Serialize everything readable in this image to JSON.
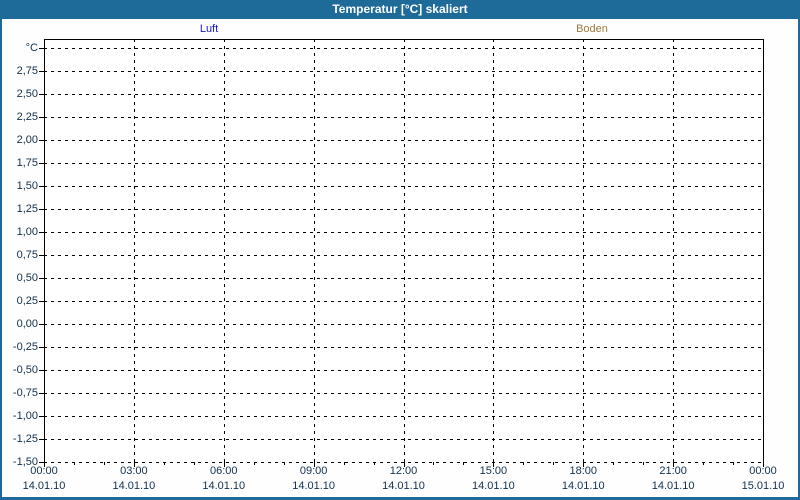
{
  "window": {
    "title": "Temperatur [°C] skaliert",
    "titlebar_color": "#1e6b9a",
    "border_color": "#1e6b9a",
    "background_color": "#fdfefd"
  },
  "chart_data": {
    "type": "line",
    "title": "Temperatur [°C] skaliert",
    "grid": "dashed",
    "grid_color": "#000000",
    "plot_background": "#ffffff",
    "axis_label_color": "#13304c",
    "y_axis": {
      "unit": "°C",
      "min": -1.5,
      "max": 3.0,
      "tick_step": 0.25,
      "tick_labels": [
        "°C",
        "2,75",
        "2,50",
        "2,25",
        "2,00",
        "1,75",
        "1,50",
        "1,25",
        "1,00",
        "0,75",
        "0,50",
        "0,25",
        "0,00",
        "-0,25",
        "-0,50",
        "-0,75",
        "-1,00",
        "-1,25",
        "-1,50"
      ]
    },
    "x_axis": {
      "major_tick_interval_hours": 3,
      "minor_tick_interval_hours": 1,
      "major_ticks": [
        {
          "time": "00:00",
          "date": "14.01.10"
        },
        {
          "time": "03:00",
          "date": "14.01.10"
        },
        {
          "time": "06:00",
          "date": "14.01.10"
        },
        {
          "time": "09:00",
          "date": "14.01.10"
        },
        {
          "time": "12:00",
          "date": "14.01.10"
        },
        {
          "time": "15:00",
          "date": "14.01.10"
        },
        {
          "time": "18:00",
          "date": "14.01.10"
        },
        {
          "time": "21:00",
          "date": "14.01.10"
        },
        {
          "time": "00:00",
          "date": "15.01.10"
        }
      ]
    },
    "series": [
      {
        "name": "Luft",
        "color": "#1515d6",
        "values": []
      },
      {
        "name": "Boden",
        "color": "#a0793c",
        "values": []
      }
    ]
  }
}
